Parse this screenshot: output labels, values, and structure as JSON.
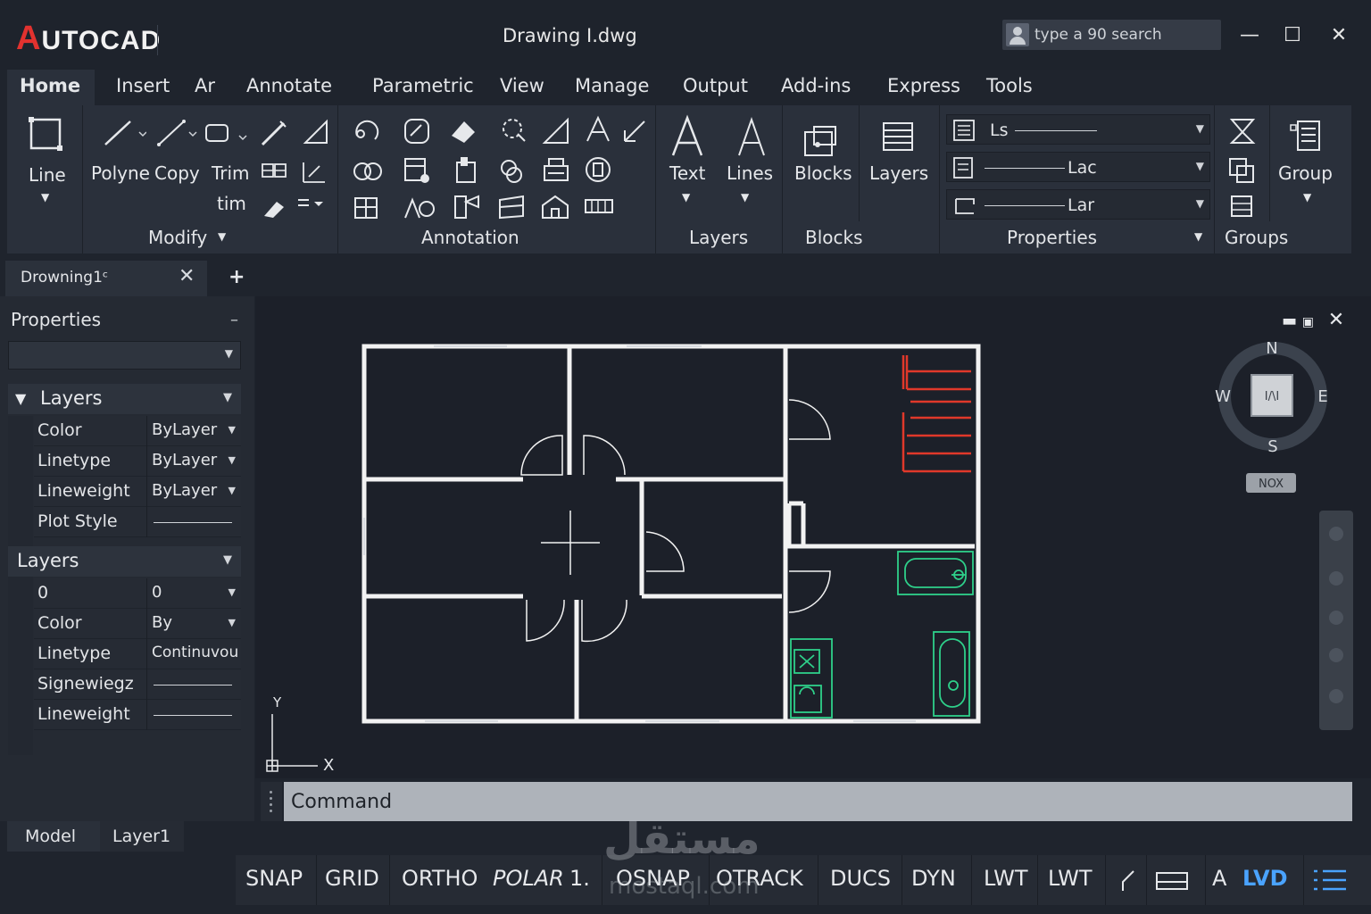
{
  "app": {
    "logo_first": "A",
    "logo_rest": "UTOCAD",
    "doc_title": "Drawing I.dwg"
  },
  "search": {
    "placeholder": "type a 90 search"
  },
  "window": {
    "minimize": "—",
    "maximize": "☐",
    "close": "✕"
  },
  "ribbon_tabs": [
    "Home",
    "Insert",
    "Ar",
    "Annotate",
    "Parametric",
    "View",
    "Manage",
    "Output",
    "Add-ins",
    "Express",
    "Tools"
  ],
  "ribbon": {
    "draw": {
      "line_label": "Line"
    },
    "modify": {
      "title": "Modify",
      "polyne": "Polyne",
      "copy": "Copy",
      "trim": "Trim",
      "tim": "tim"
    },
    "annotation": {
      "title": "Annotation"
    },
    "layers_panel": {
      "title": "Layers",
      "text_label": "Text",
      "lines_label": "Lines"
    },
    "blocks_panel": {
      "title": "Blocks",
      "blocks_label": "Blocks",
      "layers_label": "Layers"
    },
    "properties_panel": {
      "title": "Properties",
      "row1": "Ls",
      "row2": "Lac",
      "row3": "Lar"
    },
    "groups_panel": {
      "title": "Groups",
      "group_label": "Group"
    }
  },
  "file_tab": {
    "label": "Drowning1ᶜ",
    "close": "✕",
    "add": "+"
  },
  "properties": {
    "title": "Properties",
    "minimize": "–",
    "section1": {
      "title": "Layers",
      "rows": [
        {
          "key": "Color",
          "value": "ByLayer"
        },
        {
          "key": "Linetype",
          "value": "ByLayer"
        },
        {
          "key": "Lineweight",
          "value": "ByLayer"
        },
        {
          "key": "Plot Style",
          "value": ""
        }
      ]
    },
    "section2": {
      "title": "Layers",
      "rows": [
        {
          "key": "0",
          "value": "0"
        },
        {
          "key": "Color",
          "value": "By"
        },
        {
          "key": "Linetype",
          "value": "Continuvou"
        },
        {
          "key": "Signewiegz",
          "value": ""
        },
        {
          "key": "Lineweight",
          "value": ""
        }
      ]
    }
  },
  "viewcube": {
    "n": "N",
    "s": "S",
    "e": "E",
    "w": "W",
    "center": "I/\\I",
    "wcs": "NOX"
  },
  "ucs": {
    "x": "X",
    "y": "Y"
  },
  "command": {
    "placeholder": "Command"
  },
  "layout_tabs": [
    "Model",
    "Layer1"
  ],
  "status_bar": [
    "SNAP",
    "GRID",
    "ORTHO",
    "POLAR",
    "1.",
    "OSNAP",
    "OTRACK",
    "DUCS",
    "DYN",
    "LWT",
    "LWT",
    "A",
    "LVD"
  ],
  "watermark": {
    "main": "مستقل",
    "sub": "mostaql.com"
  },
  "colors": {
    "stairs": "#e0382a",
    "fixtures": "#2ed08a",
    "walls": "#f2f2f2",
    "accent": "#4aa3ff"
  }
}
